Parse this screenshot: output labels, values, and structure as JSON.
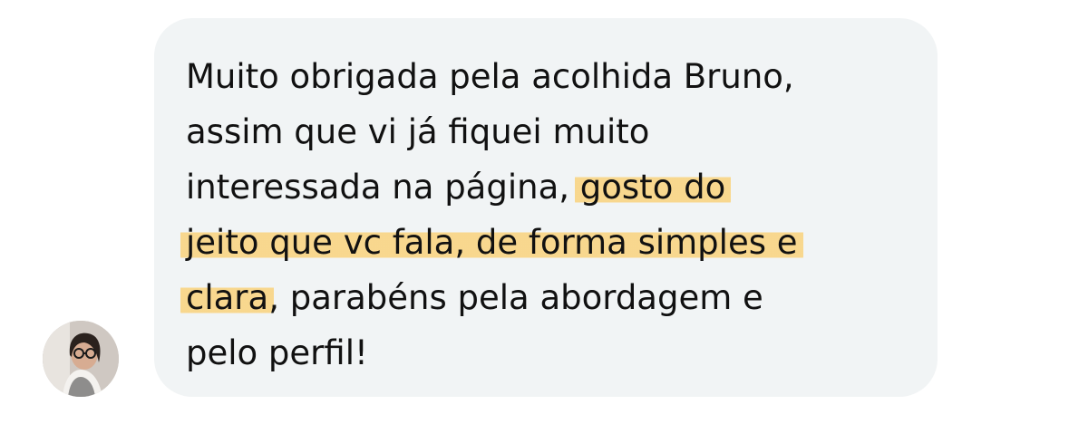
{
  "message": {
    "lines": [
      "Muito obrigada pela acolhida Bruno,",
      "assim que vi já fiquei muito",
      "interessada na página, ",
      "gosto do",
      "jeito que vc fala, de forma simples e",
      "clara",
      ", parabéns pela abordagem e",
      "pelo perfil!"
    ]
  },
  "colors": {
    "bubble": "#f1f4f5",
    "text": "#111111",
    "highlight": "#fad178"
  },
  "avatar": {
    "icon": "user-avatar-photo"
  }
}
